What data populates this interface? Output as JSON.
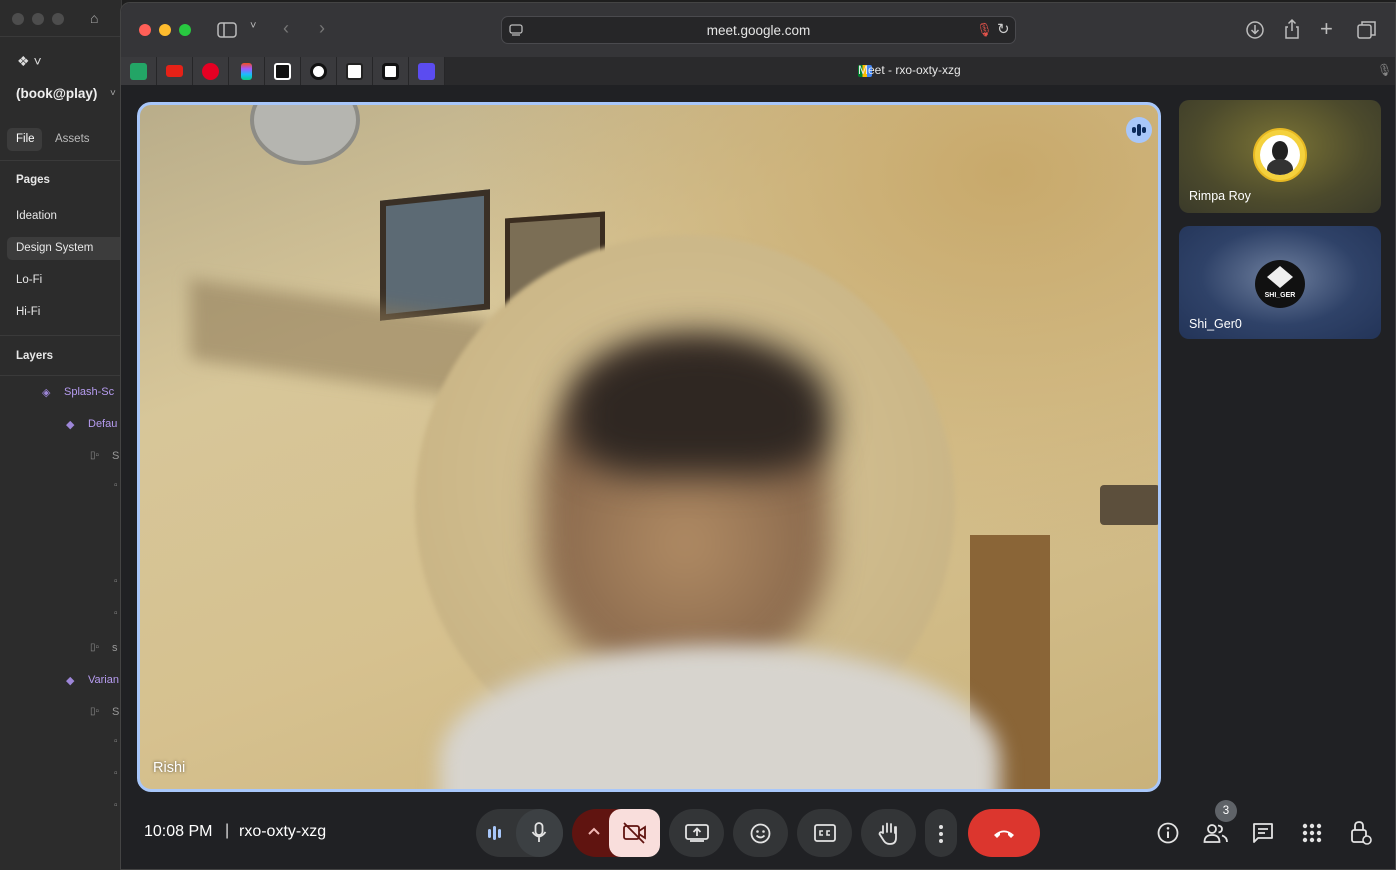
{
  "figma": {
    "file_name": "(book@play)",
    "tabs": [
      "File",
      "Assets"
    ],
    "pages_header": "Pages",
    "pages": [
      "Ideation",
      "Design System",
      "Lo-Fi",
      "Hi-Fi"
    ],
    "layers_header": "Layers",
    "layers": [
      "Splash-Sc",
      "Defau",
      "S",
      "s",
      "Varian",
      "S"
    ]
  },
  "browser": {
    "url": "meet.google.com",
    "tab_title": "Meet - rxo-oxty-xzg",
    "bookmarks": [
      "sheets-icon",
      "youtube-icon",
      "pinterest-icon",
      "figma-icon",
      "framer-icon",
      "openai-icon",
      "notion-icon",
      "uplabs-icon",
      "ux-icon"
    ]
  },
  "meet": {
    "main_speaker": "Rishi",
    "participants": [
      {
        "name": "Rimpa Roy"
      },
      {
        "name": "Shi_Ger0",
        "avatar_text": "SHI_GER"
      }
    ],
    "time": "10:08 PM",
    "separator": "|",
    "meeting_code": "rxo-oxty-xzg",
    "people_count": "3"
  },
  "colors": {
    "accent_border": "#a8c7fa",
    "end_call": "#dc362e",
    "camera_off_bg": "#f9dedc",
    "camera_menu_bg": "#601410"
  }
}
